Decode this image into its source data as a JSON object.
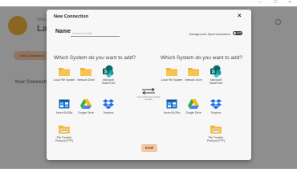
{
  "window": {
    "controls": {
      "minimize": "—",
      "maximize": "☐",
      "close": "✕"
    }
  },
  "background": {
    "app_subtitle": "Welcome to",
    "app_title": "Last...",
    "new_button": "New Connection",
    "section_title": "Your Connections"
  },
  "modal": {
    "title": "New Connection",
    "close_glyph": "×",
    "name_label": "Name",
    "name_placeholder": "Connection Title",
    "bg_sync_label": "Background Synchronization",
    "bg_sync_state": "OFF",
    "left_title": "Which System do you want to add?",
    "right_title": "Which System do you want to add?",
    "services": [
      {
        "label": "Local File System",
        "icon": "folder-icon"
      },
      {
        "label": "Network Drive",
        "icon": "folder-icon"
      },
      {
        "label": "Microsoft SharePoint",
        "icon": "sharepoint-icon"
      },
      {
        "label": "Azure BLOBs",
        "icon": "azure-blob-icon"
      },
      {
        "label": "Google Drive",
        "icon": "google-drive-icon"
      },
      {
        "label": "Dropbox",
        "icon": "dropbox-icon"
      },
      {
        "label": "File Transfer Protocol (FTP)",
        "icon": "ftp-folder-icon"
      }
    ],
    "transfer_label": "Lets synchronise storage services",
    "done_label": "DONE"
  },
  "colors": {
    "accent": "#f6c7a6",
    "folder": "#f2b134",
    "sharepoint": "#0f7f73",
    "azure": "#1a73c8",
    "dropbox": "#1f6fe6"
  }
}
